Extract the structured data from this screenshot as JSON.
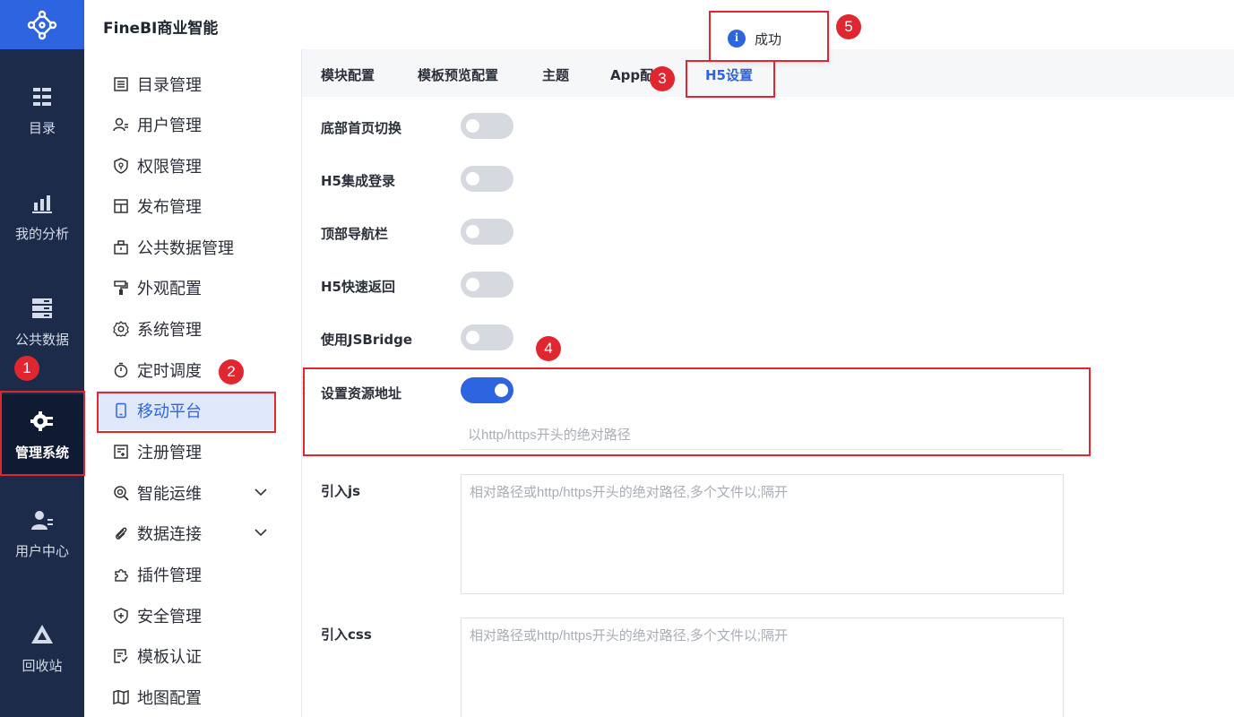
{
  "app": {
    "title": "FineBI商业智能"
  },
  "rail": [
    {
      "label": "目录",
      "icon": "catalog-icon"
    },
    {
      "label": "我的分析",
      "icon": "analysis-chart-icon"
    },
    {
      "label": "公共数据",
      "icon": "database-icon"
    },
    {
      "label": "管理系统",
      "icon": "gear-settings-icon",
      "active": true
    },
    {
      "label": "用户中心",
      "icon": "user-center-icon"
    },
    {
      "label": "回收站",
      "icon": "recycle-bin-icon"
    }
  ],
  "menu": [
    {
      "label": "目录管理",
      "icon": "list-icon"
    },
    {
      "label": "用户管理",
      "icon": "user-icon"
    },
    {
      "label": "权限管理",
      "icon": "shield-key-icon"
    },
    {
      "label": "发布管理",
      "icon": "publish-icon"
    },
    {
      "label": "公共数据管理",
      "icon": "briefcase-icon"
    },
    {
      "label": "外观配置",
      "icon": "paint-roller-icon"
    },
    {
      "label": "系统管理",
      "icon": "cog-icon"
    },
    {
      "label": "定时调度",
      "icon": "stopwatch-icon"
    },
    {
      "label": "移动平台",
      "icon": "mobile-icon",
      "active": true
    },
    {
      "label": "注册管理",
      "icon": "register-icon"
    },
    {
      "label": "智能运维",
      "icon": "ops-icon",
      "expandable": true
    },
    {
      "label": "数据连接",
      "icon": "paperclip-icon",
      "expandable": true
    },
    {
      "label": "插件管理",
      "icon": "puzzle-icon"
    },
    {
      "label": "安全管理",
      "icon": "shield-plus-icon"
    },
    {
      "label": "模板认证",
      "icon": "certificate-icon"
    },
    {
      "label": "地图配置",
      "icon": "map-icon"
    }
  ],
  "tabs": [
    "模块配置",
    "模板预览配置",
    "主题",
    "App配",
    "H5设置"
  ],
  "active_tab": "H5设置",
  "settings": [
    {
      "label": "底部首页切换",
      "on": false
    },
    {
      "label": "H5集成登录",
      "on": false
    },
    {
      "label": "顶部导航栏",
      "on": false
    },
    {
      "label": "H5快速返回",
      "on": false
    },
    {
      "label": "使用JSBridge",
      "on": false
    },
    {
      "label": "设置资源地址",
      "on": true
    }
  ],
  "resource_url": {
    "value": "",
    "placeholder": "以http/https开头的绝对路径"
  },
  "import_js": {
    "label": "引入js",
    "value": "",
    "placeholder": "相对路径或http/https开头的绝对路径,多个文件以;隔开"
  },
  "import_css": {
    "label": "引入css",
    "value": "",
    "placeholder": "相对路径或http/https开头的绝对路径,多个文件以;隔开"
  },
  "toast": {
    "text": "成功",
    "icon": "info-icon"
  },
  "annotations": [
    "1",
    "2",
    "3",
    "4",
    "5"
  ],
  "colors": {
    "accent": "#2d64e0",
    "rail": "#1c2b4a",
    "highlight": "#e0262f"
  }
}
